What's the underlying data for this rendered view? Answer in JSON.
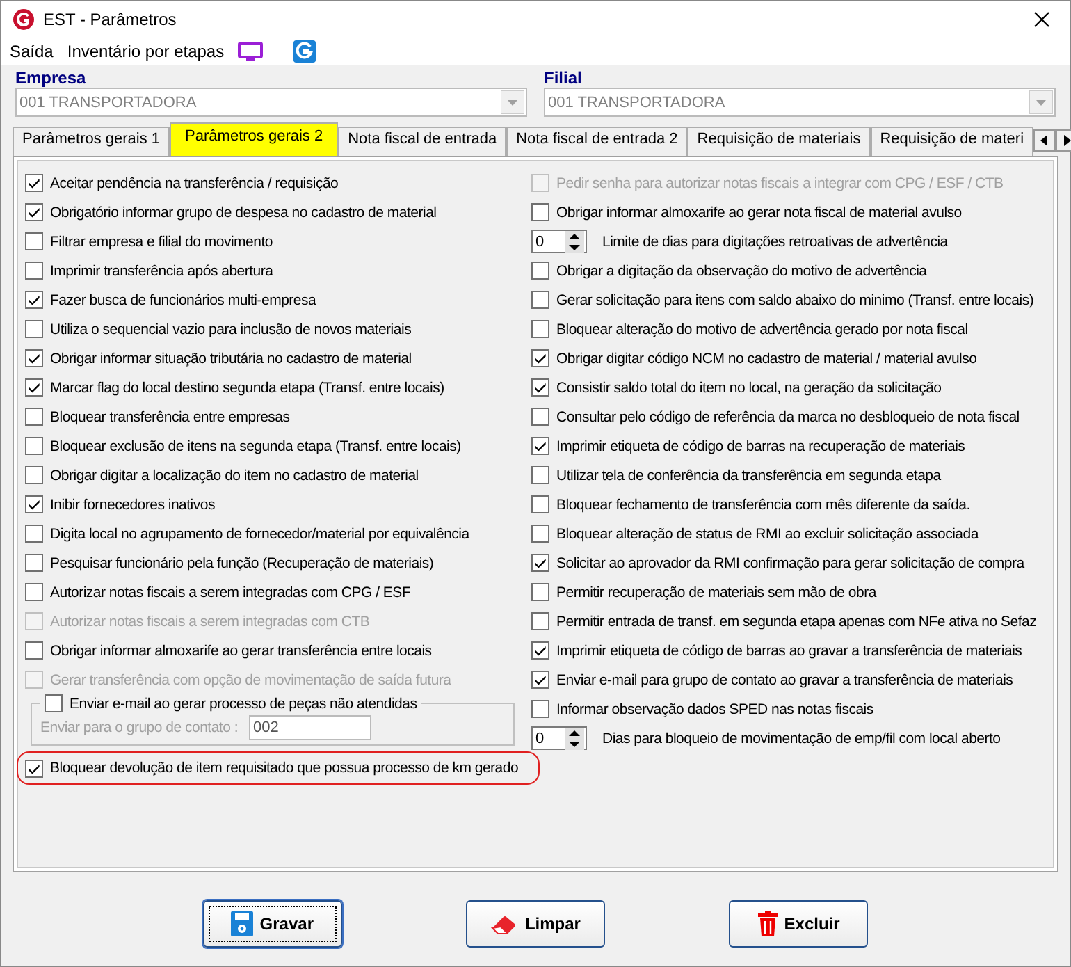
{
  "window": {
    "title": "EST - Parâmetros"
  },
  "menu": [
    "Saída",
    "Inventário por etapas"
  ],
  "empresa": {
    "label": "Empresa",
    "value": "001 TRANSPORTADORA"
  },
  "filial": {
    "label": "Filial",
    "value": "001 TRANSPORTADORA"
  },
  "tabs": [
    {
      "label": "Parâmetros gerais 1",
      "selected": false
    },
    {
      "label": "Parâmetros gerais 2",
      "selected": true
    },
    {
      "label": "Nota fiscal de entrada",
      "selected": false
    },
    {
      "label": "Nota fiscal de entrada 2",
      "selected": false
    },
    {
      "label": "Requisição de materiais",
      "selected": false
    },
    {
      "label": "Requisição de materi",
      "selected": false
    }
  ],
  "left_options": [
    {
      "kind": "checkbox",
      "label": "Aceitar pendência na transferência / requisição",
      "checked": true,
      "disabled": false
    },
    {
      "kind": "checkbox",
      "label": "Obrigatório informar grupo de despesa no cadastro de material",
      "checked": true,
      "disabled": false
    },
    {
      "kind": "checkbox",
      "label": "Filtrar empresa e filial do movimento",
      "checked": false,
      "disabled": false
    },
    {
      "kind": "checkbox",
      "label": "Imprimir transferência após abertura",
      "checked": false,
      "disabled": false
    },
    {
      "kind": "checkbox",
      "label": "Fazer busca de funcionários multi-empresa",
      "checked": true,
      "disabled": false
    },
    {
      "kind": "checkbox",
      "label": "Utiliza o sequencial vazio para inclusão de novos materiais",
      "checked": false,
      "disabled": false
    },
    {
      "kind": "checkbox",
      "label": "Obrigar informar situação tributária no cadastro de material",
      "checked": true,
      "disabled": false
    },
    {
      "kind": "checkbox",
      "label": "Marcar flag do local destino segunda etapa (Transf. entre locais)",
      "checked": true,
      "disabled": false
    },
    {
      "kind": "checkbox",
      "label": "Bloquear transferência entre empresas",
      "checked": false,
      "disabled": false
    },
    {
      "kind": "checkbox",
      "label": "Bloquear exclusão de itens na segunda etapa (Transf. entre locais)",
      "checked": false,
      "disabled": false
    },
    {
      "kind": "checkbox",
      "label": "Obrigar digitar a localização do item no cadastro de material",
      "checked": false,
      "disabled": false
    },
    {
      "kind": "checkbox",
      "label": "Inibir fornecedores inativos",
      "checked": true,
      "disabled": false
    },
    {
      "kind": "checkbox",
      "label": "Digita local no agrupamento de fornecedor/material por equivalência",
      "checked": false,
      "disabled": false
    },
    {
      "kind": "checkbox",
      "label": "Pesquisar funcionário pela função (Recuperação de materiais)",
      "checked": false,
      "disabled": false
    },
    {
      "kind": "checkbox",
      "label": "Autorizar notas fiscais a serem integradas com CPG / ESF",
      "checked": false,
      "disabled": false
    },
    {
      "kind": "checkbox",
      "label": "Autorizar notas fiscais a serem integradas com CTB",
      "checked": false,
      "disabled": true
    },
    {
      "kind": "checkbox",
      "label": "Obrigar informar almoxarife ao gerar transferência entre locais",
      "checked": false,
      "disabled": false
    },
    {
      "kind": "checkbox",
      "label": "Gerar transferência com opção de movimentação de saída futura",
      "checked": false,
      "disabled": true
    },
    {
      "kind": "group",
      "label": "Enviar e-mail ao gerar processo de peças não atendidas",
      "checked": false,
      "field_label": "Enviar para o grupo de contato :",
      "field_value": "002"
    },
    {
      "kind": "checkbox",
      "label": "Bloquear devolução de item requisitado que possua processo de km gerado",
      "checked": true,
      "disabled": false,
      "highlighted": true
    }
  ],
  "right_options": [
    {
      "kind": "checkbox",
      "label": "Pedir senha para autorizar notas fiscais a integrar com CPG / ESF / CTB",
      "checked": false,
      "disabled": true
    },
    {
      "kind": "checkbox",
      "label": "Obrigar informar almoxarife ao gerar nota fiscal de material avulso",
      "checked": false,
      "disabled": false
    },
    {
      "kind": "spin",
      "label": "Limite de dias para digitações retroativas de advertência",
      "field_value": "0"
    },
    {
      "kind": "checkbox",
      "label": "Obrigar a digitação da observação do motivo de advertência",
      "checked": false,
      "disabled": false
    },
    {
      "kind": "checkbox",
      "label": "Gerar solicitação para itens com saldo abaixo do minimo (Transf. entre locais)",
      "checked": false,
      "disabled": false
    },
    {
      "kind": "checkbox",
      "label": "Bloquear alteração do motivo de advertência gerado por nota fiscal",
      "checked": false,
      "disabled": false
    },
    {
      "kind": "checkbox",
      "label": "Obrigar digitar código NCM no cadastro de material / material avulso",
      "checked": true,
      "disabled": false
    },
    {
      "kind": "checkbox",
      "label": "Consistir saldo total do item no local, na geração da solicitação",
      "checked": true,
      "disabled": false
    },
    {
      "kind": "checkbox",
      "label": "Consultar pelo código de referência da marca no desbloqueio de nota fiscal",
      "checked": false,
      "disabled": false
    },
    {
      "kind": "checkbox",
      "label": "Imprimir etiqueta de código de barras na recuperação de materiais",
      "checked": true,
      "disabled": false
    },
    {
      "kind": "checkbox",
      "label": "Utilizar tela de conferência da transferência em segunda etapa",
      "checked": false,
      "disabled": false
    },
    {
      "kind": "checkbox",
      "label": "Bloquear fechamento de transferência com mês diferente da saída.",
      "checked": false,
      "disabled": false
    },
    {
      "kind": "checkbox",
      "label": "Bloquear alteração de status de RMI ao excluir solicitação associada",
      "checked": false,
      "disabled": false
    },
    {
      "kind": "checkbox",
      "label": "Solicitar ao aprovador da RMI confirmação para gerar solicitação de compra",
      "checked": true,
      "disabled": false
    },
    {
      "kind": "checkbox",
      "label": "Permitir recuperação de materiais sem mão de obra",
      "checked": false,
      "disabled": false
    },
    {
      "kind": "checkbox",
      "label": "Permitir entrada de transf. em segunda etapa apenas com NFe ativa no Sefaz",
      "checked": false,
      "disabled": false
    },
    {
      "kind": "checkbox",
      "label": "Imprimir etiqueta de código de barras ao gravar a transferência de materiais",
      "checked": true,
      "disabled": false
    },
    {
      "kind": "checkbox",
      "label": "Enviar e-mail para grupo de contato ao gravar a transferência de materiais",
      "checked": true,
      "disabled": false
    },
    {
      "kind": "checkbox",
      "label": "Informar observação dados SPED nas notas fiscais",
      "checked": false,
      "disabled": false
    },
    {
      "kind": "spin",
      "label": "Dias para bloqueio de movimentação de emp/fil com local aberto",
      "field_value": "0"
    }
  ],
  "buttons": [
    {
      "kind": "save",
      "label": "Gravar",
      "focused": true
    },
    {
      "kind": "clear",
      "label": "Limpar",
      "focused": false
    },
    {
      "kind": "delete",
      "label": "Excluir",
      "focused": false
    }
  ]
}
